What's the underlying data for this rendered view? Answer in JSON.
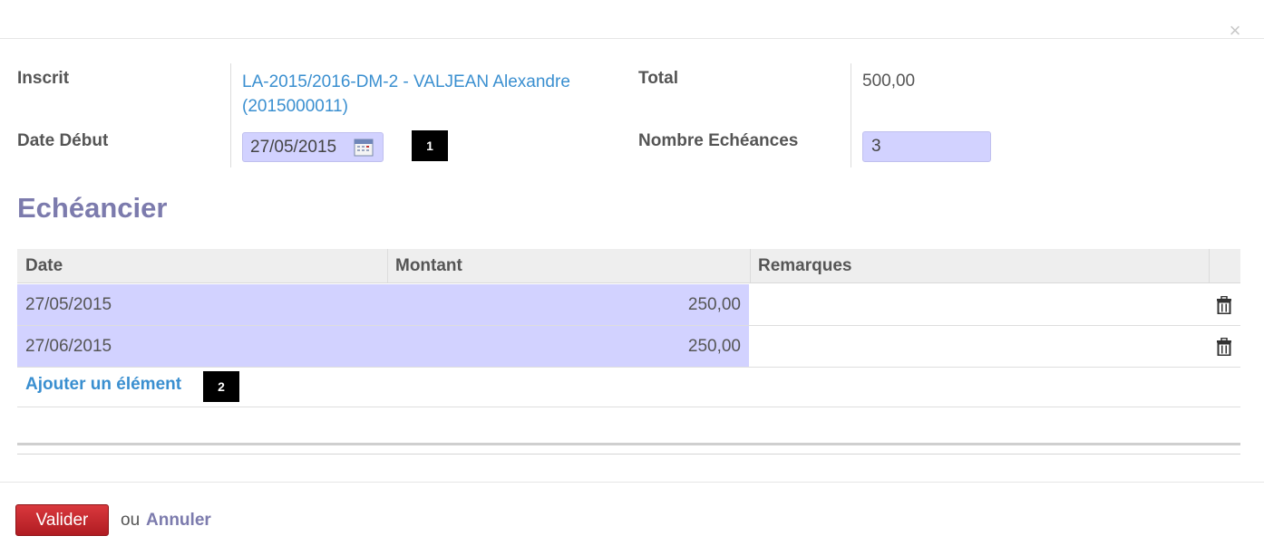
{
  "dialog": {
    "close_icon": "×"
  },
  "form": {
    "inscrit_label": "Inscrit",
    "inscrit_value_line1": "LA-2015/2016-DM-2 - VALJEAN Alexandre",
    "inscrit_value_line2": "(2015000011)",
    "date_debut_label": "Date Début",
    "date_debut_value": "27/05/2015",
    "total_label": "Total",
    "total_value": "500,00",
    "nombre_label": "Nombre Echéances",
    "nombre_value": "3"
  },
  "markers": {
    "m1": "1",
    "m2": "2"
  },
  "section": {
    "title": "Echéancier"
  },
  "table": {
    "columns": [
      "Date",
      "Montant",
      "Remarques"
    ],
    "rows": [
      {
        "date": "27/05/2015",
        "montant": "250,00",
        "remarques": ""
      },
      {
        "date": "27/06/2015",
        "montant": "250,00",
        "remarques": ""
      }
    ],
    "add_label": "Ajouter un élément"
  },
  "footer": {
    "valider_label": "Valider",
    "ou_label": "ou",
    "annuler_label": "Annuler"
  },
  "colors": {
    "accent_link": "#3a8fd0",
    "highlight": "#d2d2ff",
    "title": "#7c7bad",
    "primary_button": "#c72a30"
  }
}
